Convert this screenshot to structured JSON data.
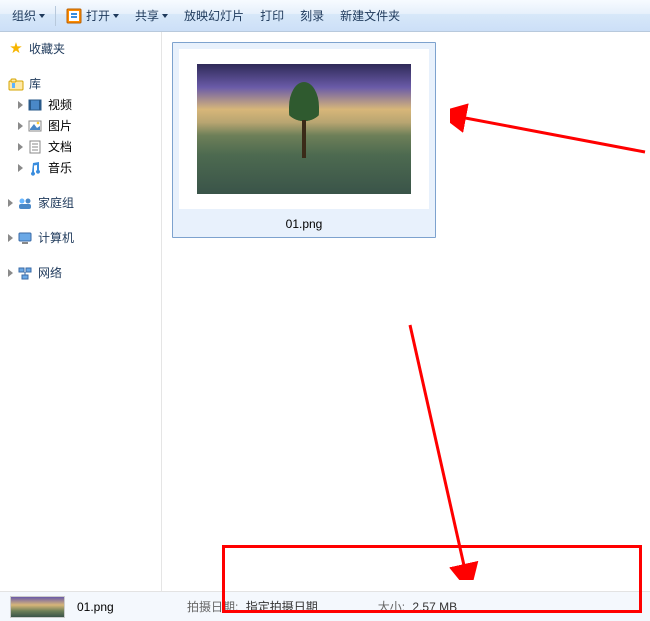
{
  "toolbar": {
    "organize": "组织",
    "open": "打开",
    "share": "共享",
    "slideshow": "放映幻灯片",
    "print": "打印",
    "burn": "刻录",
    "newfolder": "新建文件夹"
  },
  "sidebar": {
    "favorites": "收藏夹",
    "libraries": "库",
    "lib_items": {
      "video": "视频",
      "pictures": "图片",
      "documents": "文档",
      "music": "音乐"
    },
    "homegroup": "家庭组",
    "computer": "计算机",
    "network": "网络"
  },
  "file": {
    "name": "01.png"
  },
  "status": {
    "name": "01.png",
    "date_label": "拍摄日期:",
    "date_value": "指定拍摄日期",
    "size_label": "大小:",
    "size_value": "2.57 MB"
  }
}
